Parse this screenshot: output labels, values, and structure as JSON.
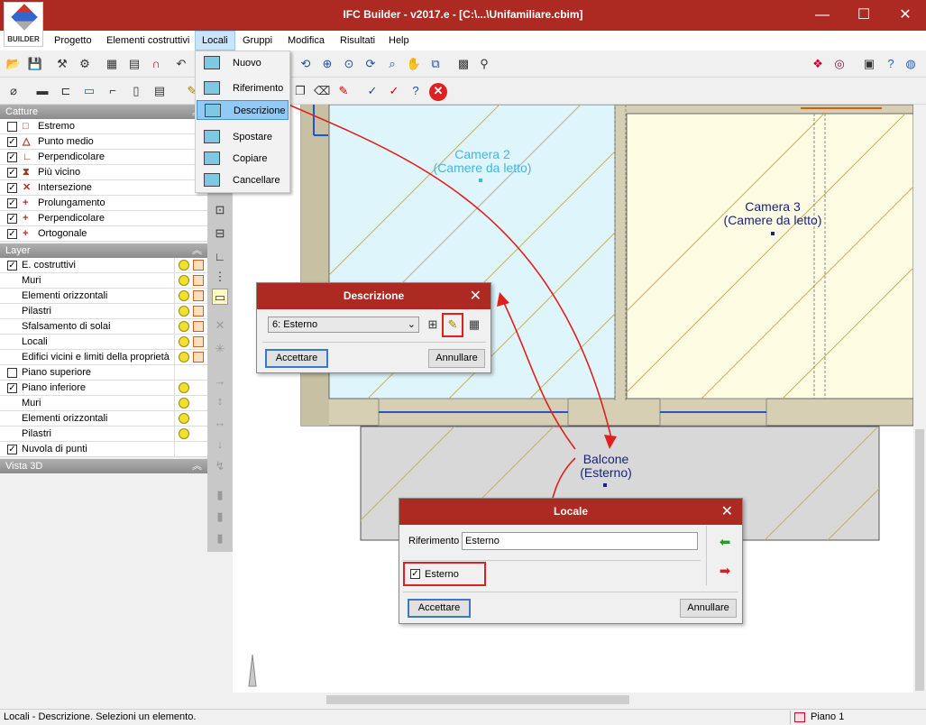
{
  "app": {
    "title": "IFC Builder - v2017.e - [C:\\...\\Unifamiliare.cbim]",
    "logo_text": "BUILDER"
  },
  "window_controls": {
    "minimize": "—",
    "maximize": "☐",
    "close": "✕"
  },
  "menubar": [
    "Progetto",
    "Elementi costruttivi",
    "Locali",
    "Gruppi",
    "Modifica",
    "Risultati",
    "Help"
  ],
  "locali_menu": {
    "items": [
      {
        "label": "Nuovo"
      },
      {
        "label": "Riferimento"
      },
      {
        "label": "Descrizione"
      },
      {
        "label": "Spostare"
      },
      {
        "label": "Copiare"
      },
      {
        "label": "Cancellare"
      }
    ],
    "selected": "Descrizione"
  },
  "catture": {
    "title": "Catture",
    "items": [
      {
        "label": "Estremo",
        "checked": false,
        "symbol": "□"
      },
      {
        "label": "Punto medio",
        "checked": true,
        "symbol": "△"
      },
      {
        "label": "Perpendicolare",
        "checked": true,
        "symbol": "∟"
      },
      {
        "label": "Più vicino",
        "checked": true,
        "symbol": "⧗"
      },
      {
        "label": "Intersezione",
        "checked": true,
        "symbol": "✕"
      },
      {
        "label": "Prolungamento",
        "checked": true,
        "symbol": "+"
      },
      {
        "label": "Perpendicolare",
        "checked": true,
        "symbol": "+"
      },
      {
        "label": "Ortogonale",
        "checked": true,
        "symbol": "+"
      }
    ]
  },
  "layer": {
    "title": "Layer",
    "items": [
      {
        "label": "E. costruttivi",
        "checked": true,
        "bulb": true,
        "cube": true,
        "indent": false
      },
      {
        "label": "Muri",
        "checked": null,
        "bulb": true,
        "cube": true,
        "indent": true
      },
      {
        "label": "Elementi orizzontali",
        "checked": null,
        "bulb": true,
        "cube": true,
        "indent": true
      },
      {
        "label": "Pilastri",
        "checked": null,
        "bulb": true,
        "cube": true,
        "indent": true
      },
      {
        "label": "Sfalsamento di solai",
        "checked": null,
        "bulb": true,
        "cube": true,
        "indent": true
      },
      {
        "label": "Locali",
        "checked": null,
        "bulb": true,
        "cube": true,
        "indent": true
      },
      {
        "label": "Edifici vicini e limiti della proprietà",
        "checked": null,
        "bulb": true,
        "cube": true,
        "indent": true
      },
      {
        "label": "Piano superiore",
        "checked": false,
        "bulb": false,
        "cube": false,
        "indent": false
      },
      {
        "label": "Piano inferiore",
        "checked": true,
        "bulb": true,
        "cube": false,
        "indent": false
      },
      {
        "label": "Muri",
        "checked": null,
        "bulb": true,
        "cube": false,
        "indent": true
      },
      {
        "label": "Elementi orizzontali",
        "checked": null,
        "bulb": true,
        "cube": false,
        "indent": true
      },
      {
        "label": "Pilastri",
        "checked": null,
        "bulb": true,
        "cube": false,
        "indent": true
      },
      {
        "label": "Nuvola di punti",
        "checked": true,
        "bulb": false,
        "cube": false,
        "indent": false
      }
    ]
  },
  "vista3d": {
    "title": "Vista 3D"
  },
  "canvas": {
    "rooms": [
      {
        "name": "Camera 2",
        "type": "(Camere da letto)",
        "color": "#45b5e0"
      },
      {
        "name": "Camera 3",
        "type": "(Camere da letto)",
        "color": "#1a237e"
      },
      {
        "name": "Balcone",
        "type": "(Esterno)",
        "color": "#1a237e"
      }
    ]
  },
  "dialog_descrizione": {
    "title": "Descrizione",
    "select_value": "6: Esterno",
    "accept": "Accettare",
    "cancel": "Annullare"
  },
  "dialog_locale": {
    "title": "Locale",
    "ref_label": "Riferimento",
    "ref_value": "Esterno",
    "checkbox_label": "Esterno",
    "checkbox_checked": true,
    "accept": "Accettare",
    "cancel": "Annullare"
  },
  "status": {
    "text": "Locali - Descrizione.  Selezioni un elemento.",
    "floor": "Piano 1"
  },
  "colors": {
    "titlebar": "#ac2a22",
    "annotation": "#e02020",
    "room_blue": "#dff5fc",
    "room_yellow": "#fdfbe1"
  }
}
